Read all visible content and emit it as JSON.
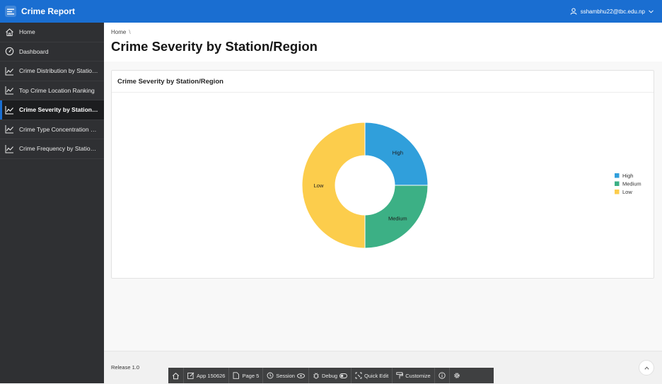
{
  "app": {
    "title": "Crime Report",
    "user": "sshambhu22@tbc.edu.np"
  },
  "sidebar": {
    "items": [
      {
        "label": "Home",
        "icon": "home-icon"
      },
      {
        "label": "Dashboard",
        "icon": "dashboard-icon"
      },
      {
        "label": "Crime Distribution by Station/Region",
        "icon": "line-chart-icon"
      },
      {
        "label": "Top Crime Location Ranking",
        "icon": "line-chart-icon"
      },
      {
        "label": "Crime Severity by Station/Region",
        "icon": "line-chart-icon",
        "active": true
      },
      {
        "label": "Crime Type Concentration by Location",
        "icon": "line-chart-icon"
      },
      {
        "label": "Crime Frequency by Station/Region",
        "icon": "line-chart-icon"
      }
    ]
  },
  "breadcrumb": {
    "home": "Home",
    "separator": "\\"
  },
  "page": {
    "title": "Crime Severity by Station/Region"
  },
  "region": {
    "title": "Crime Severity by Station/Region"
  },
  "chart_data": {
    "type": "pie",
    "donut": true,
    "categories": [
      "High",
      "Medium",
      "Low"
    ],
    "values": [
      25,
      25,
      50
    ],
    "colors": [
      "#309fdb",
      "#3cb085",
      "#fccd4c"
    ],
    "legend": {
      "position": "right",
      "entries": [
        "High",
        "Medium",
        "Low"
      ]
    }
  },
  "footer": {
    "release": "Release 1.0"
  },
  "devbar": {
    "app": "App 150626",
    "page": "Page 5",
    "session": "Session",
    "debug": "Debug",
    "quick_edit": "Quick Edit",
    "customize": "Customize"
  }
}
